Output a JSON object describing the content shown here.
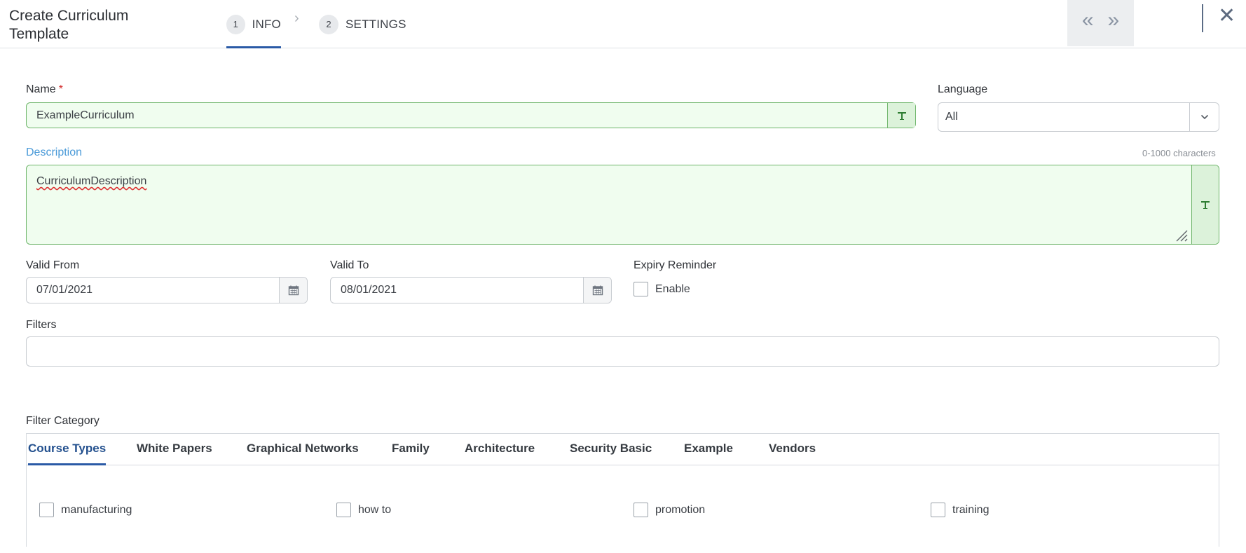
{
  "header": {
    "title": "Create Curriculum Template",
    "steps": [
      {
        "number": "1",
        "label": "INFO"
      },
      {
        "number": "2",
        "label": "SETTINGS"
      }
    ]
  },
  "form": {
    "name": {
      "label": "Name",
      "required_mark": "*",
      "value": "ExampleCurriculum"
    },
    "language": {
      "label": "Language",
      "value": "All"
    },
    "description": {
      "label": "Description",
      "hint": "0-1000 characters",
      "value": "CurriculumDescription"
    },
    "valid_from": {
      "label": "Valid From",
      "value": "07/01/2021"
    },
    "valid_to": {
      "label": "Valid To",
      "value": "08/01/2021"
    },
    "expiry_reminder": {
      "label": "Expiry Reminder",
      "checkbox_label": "Enable",
      "checked": false
    },
    "filters": {
      "label": "Filters",
      "value": ""
    },
    "filter_category": {
      "label": "Filter Category",
      "tabs": [
        "Course Types",
        "White Papers",
        "Graphical Networks",
        "Family",
        "Architecture",
        "Security Basic",
        "Example",
        "Vendors"
      ],
      "active_tab": "Course Types",
      "options": [
        "manufacturing",
        "how to",
        "promotion",
        "training"
      ]
    }
  },
  "colors": {
    "accent": "#2a5aa6",
    "valid_field_bg": "#f0fdef",
    "valid_field_border": "#6eb56a",
    "required": "#d22b2b"
  },
  "icons": {
    "prev": "double-chevron-left-icon",
    "next": "double-chevron-right-icon",
    "close": "close-icon",
    "text_format": "text-format-icon",
    "calendar": "calendar-icon",
    "dropdown": "chevron-down-icon"
  }
}
